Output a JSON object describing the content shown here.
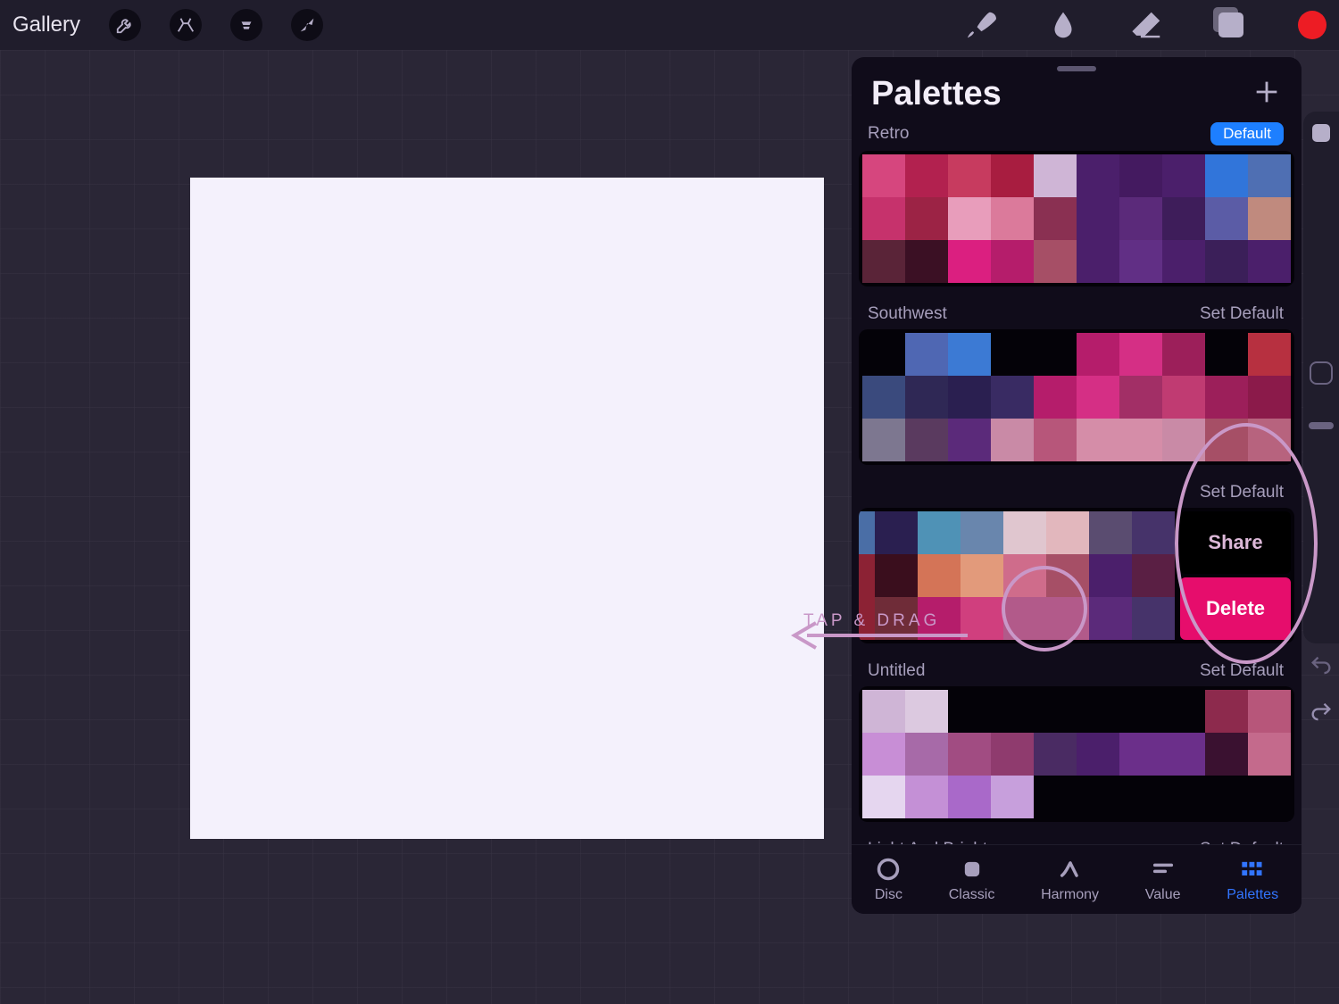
{
  "topbar": {
    "gallery": "Gallery",
    "currentColor": "#ed1c24"
  },
  "panel": {
    "title": "Palettes",
    "defaultLabel": "Default",
    "setDefaultLabel": "Set Default"
  },
  "palettes": [
    {
      "name": "Retro",
      "isDefault": true,
      "swiped": false,
      "colors": [
        "#d6467e",
        "#b2214f",
        "#c73b5f",
        "#a81d40",
        "#cfb5d6",
        "#4b1f6b",
        "#441a60",
        "#4b1f6b",
        "#3175da",
        "#4f6fb3",
        "#c6326c",
        "#9c2345",
        "#e89dbb",
        "#db7a9b",
        "#8a3052",
        "#4b1f6b",
        "#5b2a7a",
        "#3e1d5a",
        "#5b5ca6",
        "#c08a7e",
        "#5a2438",
        "#3b1024",
        "#db1f80",
        "#b51d6b",
        "#a64f66",
        "#4b1f6b",
        "#612f85",
        "#4b1f6b",
        "#3b1f59",
        "#4b1f6b"
      ]
    },
    {
      "name": "Southwest",
      "isDefault": false,
      "swiped": false,
      "colors": [
        "#040208",
        "#4f67b3",
        "#3c7ad4",
        "#040208",
        "#040208",
        "#b51d6b",
        "#d52f85",
        "#9c1f5a",
        "#040208",
        "#b73040",
        "#3a4a7d",
        "#2f2855",
        "#2a1f50",
        "#392b63",
        "#b51d6b",
        "#d52f85",
        "#a22f66",
        "#c03b72",
        "#9c1f5a",
        "#8b1a4a",
        "#7d7790",
        "#5a3a5f",
        "#5b2a7a",
        "#c98aa6",
        "#b7567a",
        "#d58da8",
        "#d58da8",
        "#c98aa6",
        "#a64f66",
        "#b7637e"
      ]
    },
    {
      "name": "",
      "isDefault": false,
      "swiped": true,
      "colors": [
        "#6f2c38",
        "#c23045",
        "#4a6ea6",
        "#2a1f50",
        "#4f92b6",
        "#6986ad",
        "#e0c6cf",
        "#e2b7bd",
        "#5a4c70",
        "#46336a",
        "#4b1524",
        "#3a0e1d",
        "#8c2234",
        "#3a0e1d",
        "#d47457",
        "#e29a7b",
        "#cf6c8b",
        "#a64f66",
        "#4b1f6b",
        "#5a1f44",
        "#b51d38",
        "#e52f55",
        "#8c2234",
        "#6f2c38",
        "#b51d6b",
        "#d03f7e",
        "#b25a8a",
        "#b25a8a",
        "#5b2a7a",
        "#46336a"
      ]
    },
    {
      "name": "Untitled",
      "isDefault": false,
      "swiped": false,
      "colors": [
        "#cfb5d6",
        "#dcc9e0",
        "#040208",
        "#040208",
        "#040208",
        "#040208",
        "#040208",
        "#040208",
        "#8d2a4d",
        "#b7567a",
        "#c88ed6",
        "#a76aa8",
        "#a14c82",
        "#8f3b6e",
        "#4a2b63",
        "#4b1f6b",
        "#6b2f8a",
        "#6b2f8a",
        "#3a1130",
        "#c46a8c",
        "#e5d6ef",
        "#c490d6",
        "#a969c9",
        "#c79fdc",
        "#040208",
        "#040208",
        "#040208",
        "#040208",
        "#040208",
        "#040208"
      ]
    },
    {
      "name": "Light And Bright",
      "isDefault": false,
      "swiped": false,
      "colors": []
    }
  ],
  "swipeActions": {
    "share": "Share",
    "delete": "Delete"
  },
  "annotation": {
    "label": "TAP & DRAG"
  },
  "tabs": {
    "disc": "Disc",
    "classic": "Classic",
    "harmony": "Harmony",
    "value": "Value",
    "palettes": "Palettes"
  }
}
